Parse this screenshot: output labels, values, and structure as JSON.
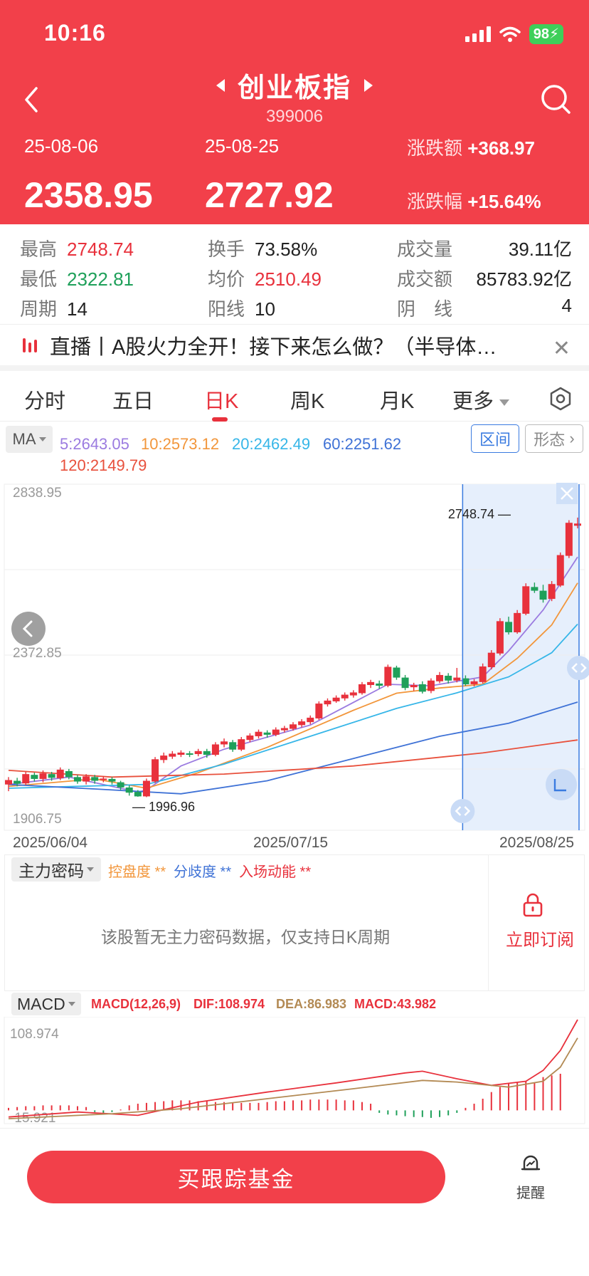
{
  "status_bar": {
    "time": "10:16",
    "battery": "98"
  },
  "header": {
    "title": "创业板指",
    "code": "399006",
    "start_date": "25-08-06",
    "end_date": "25-08-25",
    "start_price": "2358.95",
    "end_price": "2727.92",
    "change_amount_label": "涨跌额",
    "change_amount": "+368.97",
    "change_pct_label": "涨跌幅",
    "change_pct": "+15.64%"
  },
  "stats": {
    "high_label": "最高",
    "high": "2748.74",
    "low_label": "最低",
    "low": "2322.81",
    "period_label": "周期",
    "period": "14",
    "turnover_label": "换手",
    "turnover": "73.58%",
    "avg_label": "均价",
    "avg": "2510.49",
    "up_label": "阳线",
    "up": "10",
    "volume_label": "成交量",
    "volume": "39.11亿",
    "amount_label": "成交额",
    "amount": "85783.92亿",
    "down_label": "阴　线",
    "down": "4"
  },
  "news": {
    "text": "直播丨A股火力全开！接下来怎么做？（半导体…"
  },
  "tabs": [
    {
      "label": "分时"
    },
    {
      "label": "五日"
    },
    {
      "label": "日K"
    },
    {
      "label": "周K"
    },
    {
      "label": "月K"
    },
    {
      "label": "更多"
    }
  ],
  "ma": {
    "button": "MA",
    "ma5": "5:2643.05",
    "ma10": "10:2573.12",
    "ma20": "20:2462.49",
    "ma60": "60:2251.62",
    "ma120": "120:2149.79",
    "range_button": "区间",
    "shape_button": "形态"
  },
  "colors": {
    "header_red": "#f2404a",
    "up": "#e8313c",
    "down": "#1fa05a",
    "ma5": "#9b7be0",
    "ma10": "#f2963b",
    "ma20": "#36b6e8",
    "ma60": "#3f72d6",
    "ma120": "#e8503c"
  },
  "chart_data": [
    {
      "type": "candlestick",
      "title": "",
      "y_ticks": [
        "2838.95",
        "2372.85",
        "1906.75"
      ],
      "ylim": [
        1906.75,
        2838.95
      ],
      "x_ticks": [
        "2025/06/04",
        "2025/07/15",
        "2025/08/25"
      ],
      "high_label": "2748.74",
      "low_label": "1996.96",
      "candles": [
        [
          2030,
          2042,
          2012,
          2050
        ],
        [
          2040,
          2032,
          2025,
          2048
        ],
        [
          2033,
          2058,
          2028,
          2064
        ],
        [
          2056,
          2045,
          2038,
          2062
        ],
        [
          2045,
          2060,
          2036,
          2068
        ],
        [
          2058,
          2048,
          2040,
          2064
        ],
        [
          2047,
          2070,
          2042,
          2076
        ],
        [
          2066,
          2050,
          2044,
          2072
        ],
        [
          2050,
          2038,
          2032,
          2056
        ],
        [
          2038,
          2052,
          2030,
          2058
        ],
        [
          2050,
          2040,
          2032,
          2056
        ],
        [
          2042,
          2046,
          2036,
          2052
        ],
        [
          2045,
          2038,
          2030,
          2050
        ],
        [
          2036,
          2022,
          2015,
          2040
        ],
        [
          2022,
          2008,
          2000,
          2028
        ],
        [
          2010,
          1998,
          1997,
          2015
        ],
        [
          1998,
          2040,
          1996,
          2046
        ],
        [
          2038,
          2098,
          2034,
          2104
        ],
        [
          2096,
          2108,
          2088,
          2116
        ],
        [
          2105,
          2113,
          2099,
          2120
        ],
        [
          2110,
          2116,
          2104,
          2122
        ],
        [
          2114,
          2110,
          2104,
          2120
        ],
        [
          2112,
          2120,
          2106,
          2126
        ],
        [
          2120,
          2110,
          2102,
          2126
        ],
        [
          2110,
          2138,
          2106,
          2144
        ],
        [
          2138,
          2146,
          2130,
          2154
        ],
        [
          2144,
          2124,
          2118,
          2150
        ],
        [
          2124,
          2152,
          2120,
          2158
        ],
        [
          2150,
          2162,
          2144,
          2168
        ],
        [
          2160,
          2172,
          2154,
          2178
        ],
        [
          2170,
          2164,
          2156,
          2176
        ],
        [
          2164,
          2178,
          2160,
          2184
        ],
        [
          2176,
          2182,
          2170,
          2188
        ],
        [
          2180,
          2192,
          2175,
          2198
        ],
        [
          2190,
          2200,
          2184,
          2206
        ],
        [
          2198,
          2210,
          2192,
          2216
        ],
        [
          2208,
          2248,
          2204,
          2254
        ],
        [
          2246,
          2256,
          2240,
          2262
        ],
        [
          2254,
          2264,
          2250,
          2270
        ],
        [
          2262,
          2272,
          2256,
          2278
        ],
        [
          2270,
          2278,
          2264,
          2284
        ],
        [
          2276,
          2300,
          2272,
          2306
        ],
        [
          2298,
          2306,
          2290,
          2312
        ],
        [
          2302,
          2296,
          2288,
          2310
        ],
        [
          2296,
          2347,
          2292,
          2353
        ],
        [
          2345,
          2318,
          2312,
          2350
        ],
        [
          2318,
          2290,
          2284,
          2325
        ],
        [
          2292,
          2298,
          2282,
          2304
        ],
        [
          2300,
          2280,
          2275,
          2308
        ],
        [
          2282,
          2310,
          2276,
          2316
        ],
        [
          2308,
          2325,
          2303,
          2333
        ],
        [
          2323,
          2310,
          2302,
          2330
        ],
        [
          2310,
          2318,
          2305,
          2344
        ],
        [
          2316,
          2300,
          2296,
          2324
        ],
        [
          2300,
          2308,
          2294,
          2314
        ],
        [
          2306,
          2348,
          2302,
          2356
        ],
        [
          2346,
          2385,
          2340,
          2392
        ],
        [
          2383,
          2470,
          2378,
          2478
        ],
        [
          2468,
          2440,
          2434,
          2482
        ],
        [
          2440,
          2492,
          2436,
          2500
        ],
        [
          2490,
          2564,
          2486,
          2572
        ],
        [
          2562,
          2552,
          2546,
          2574
        ],
        [
          2552,
          2528,
          2520,
          2568
        ],
        [
          2530,
          2570,
          2524,
          2578
        ],
        [
          2566,
          2648,
          2562,
          2655
        ],
        [
          2646,
          2735,
          2640,
          2742
        ],
        [
          2727,
          2733,
          2720,
          2749
        ]
      ],
      "ma": {
        "ma5": [
          [
            0,
            2030
          ],
          [
            7,
            2050
          ],
          [
            15,
            2010
          ],
          [
            16,
            2015
          ],
          [
            20,
            2080
          ],
          [
            25,
            2125
          ],
          [
            35,
            2190
          ],
          [
            44,
            2300
          ],
          [
            49,
            2296
          ],
          [
            55,
            2320
          ],
          [
            58,
            2390
          ],
          [
            62,
            2500
          ],
          [
            66,
            2643
          ]
        ],
        "ma10": [
          [
            0,
            2025
          ],
          [
            10,
            2045
          ],
          [
            16,
            2020
          ],
          [
            22,
            2062
          ],
          [
            30,
            2130
          ],
          [
            40,
            2230
          ],
          [
            45,
            2276
          ],
          [
            50,
            2290
          ],
          [
            55,
            2300
          ],
          [
            59,
            2370
          ],
          [
            63,
            2460
          ],
          [
            66,
            2573
          ]
        ],
        "ma20": [
          [
            0,
            2020
          ],
          [
            16,
            2030
          ],
          [
            25,
            2085
          ],
          [
            35,
            2160
          ],
          [
            45,
            2235
          ],
          [
            52,
            2277
          ],
          [
            58,
            2320
          ],
          [
            63,
            2385
          ],
          [
            66,
            2462
          ]
        ],
        "ma60": [
          [
            0,
            2030
          ],
          [
            10,
            2018
          ],
          [
            20,
            2005
          ],
          [
            30,
            2040
          ],
          [
            40,
            2100
          ],
          [
            50,
            2160
          ],
          [
            58,
            2195
          ],
          [
            66,
            2252
          ]
        ],
        "ma120": [
          [
            0,
            2068
          ],
          [
            12,
            2050
          ],
          [
            25,
            2058
          ],
          [
            40,
            2080
          ],
          [
            55,
            2115
          ],
          [
            66,
            2150
          ]
        ]
      },
      "selected_range_start_index": 53
    },
    {
      "type": "line+bar",
      "title": "MACD(12,26,9)",
      "dif_label": "DIF:108.974",
      "dea_label": "DEA:86.983",
      "macd_label": "MACD:43.982",
      "y_ticks": [
        "108.974",
        "-15.921"
      ],
      "ylim": [
        -15.921,
        108.974
      ],
      "dif": [
        [
          0,
          -8
        ],
        [
          8,
          -2
        ],
        [
          15,
          -6
        ],
        [
          22,
          10
        ],
        [
          30,
          22
        ],
        [
          38,
          33
        ],
        [
          46,
          45
        ],
        [
          48,
          47
        ],
        [
          52,
          38
        ],
        [
          56,
          30
        ],
        [
          60,
          35
        ],
        [
          62,
          48
        ],
        [
          64,
          72
        ],
        [
          66,
          108.974
        ]
      ],
      "dea": [
        [
          0,
          -10
        ],
        [
          12,
          -4
        ],
        [
          20,
          2
        ],
        [
          30,
          14
        ],
        [
          40,
          26
        ],
        [
          48,
          36
        ],
        [
          52,
          34
        ],
        [
          58,
          28
        ],
        [
          62,
          35
        ],
        [
          64,
          52
        ],
        [
          66,
          86.983
        ]
      ],
      "macd": [
        3,
        4,
        5,
        5,
        6,
        6,
        6,
        6,
        5,
        4,
        -2,
        -3,
        -2,
        1,
        6,
        8,
        9,
        10,
        11,
        12,
        12,
        12,
        11,
        11,
        10,
        10,
        9,
        9,
        9,
        9,
        10,
        11,
        11,
        12,
        12,
        13,
        13,
        13,
        13,
        12,
        12,
        10,
        8,
        -3,
        -5,
        -6,
        -7,
        -8,
        -8,
        -9,
        -8,
        -6,
        -3,
        3,
        8,
        14,
        22,
        28,
        32,
        34,
        35,
        33,
        40,
        42,
        43.982
      ]
    }
  ],
  "main_force": {
    "button": "主力密码",
    "legend1": "控盘度 **",
    "legend2": "分歧度 **",
    "legend3": "入场动能 **",
    "empty_text": "该股暂无主力密码数据，仅支持日K周期",
    "subscribe": "立即订阅"
  },
  "macd_panel": {
    "button": "MACD"
  },
  "bottom": {
    "buy_button": "买跟踪基金",
    "remind_label": "提醒"
  }
}
